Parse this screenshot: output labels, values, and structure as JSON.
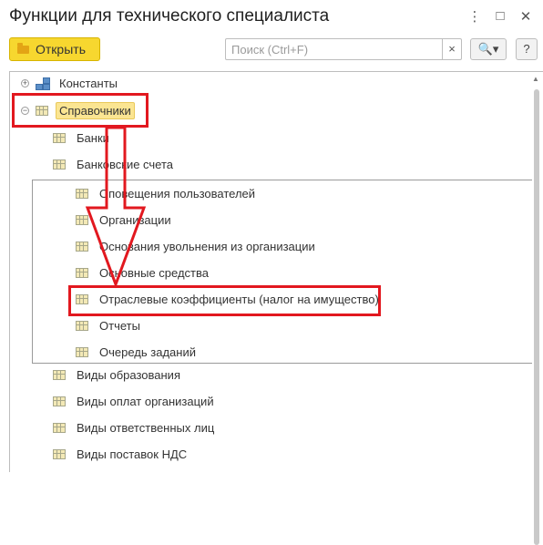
{
  "window": {
    "title": "Функции для технического специалиста",
    "controls": [
      "⋮",
      "□",
      "✕"
    ]
  },
  "toolbar": {
    "open_label": "Открыть",
    "search_placeholder": "Поиск (Ctrl+F)",
    "clear_glyph": "×",
    "search_glyph": "🔍▾",
    "help_glyph": "?"
  },
  "tree": {
    "constants": "Константы",
    "catalogs": "Справочники",
    "items_before": [
      "Банки",
      "Банковские счета"
    ],
    "group_items": [
      "Оповещения пользователей",
      "Организации",
      "Основания увольнения из организации",
      "Основные средства",
      "Отраслевые коэффициенты (налог на имущество)",
      "Отчеты",
      "Очередь заданий"
    ],
    "items_after": [
      "Виды образования",
      "Виды оплат организаций",
      "Виды ответственных лиц",
      "Виды поставок НДС"
    ]
  },
  "annotation_color": "#e2181f"
}
